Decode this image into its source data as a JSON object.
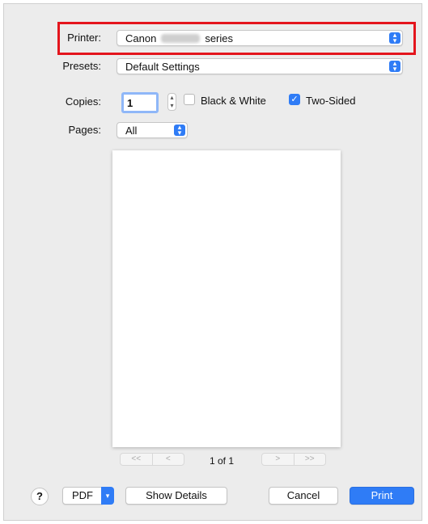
{
  "printer": {
    "label": "Printer:",
    "value_prefix": "Canon",
    "value_suffix": "series"
  },
  "presets": {
    "label": "Presets:",
    "value": "Default Settings"
  },
  "copies": {
    "label": "Copies:",
    "value": "1"
  },
  "black_white": {
    "label": "Black & White",
    "checked": false
  },
  "two_sided": {
    "label": "Two-Sided",
    "checked": true
  },
  "pages": {
    "label": "Pages:",
    "value": "All"
  },
  "preview_nav": {
    "first_label": "<<",
    "prev_label": "<",
    "page_indicator": "1 of 1",
    "next_label": ">",
    "last_label": ">>"
  },
  "footer": {
    "help_label": "?",
    "pdf_label": "PDF",
    "show_details_label": "Show Details",
    "cancel_label": "Cancel",
    "print_label": "Print"
  },
  "colors": {
    "accent": "#2f7cf6",
    "highlight_border": "#e4151d"
  }
}
